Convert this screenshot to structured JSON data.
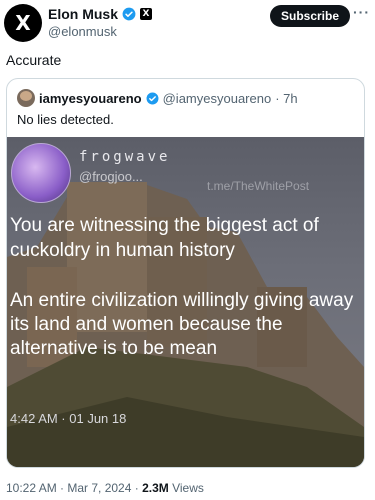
{
  "author": {
    "display_name": "Elon Musk",
    "handle": "@elonmusk",
    "avatar_icon": "x-logo-icon",
    "badge_icon": "x-affiliate-icon",
    "avatar_letter": "X",
    "badge_letter": "X"
  },
  "actions": {
    "subscribe_label": "Subscribe",
    "more_label": "···"
  },
  "tweet": {
    "text": "Accurate"
  },
  "quote": {
    "display_name": "iamyesyouareno",
    "handle": "@iamyesyouareno",
    "time": "· 7h",
    "text": "No lies detected.",
    "media": {
      "name": "frogwave",
      "handle": "@frogjoo...",
      "watermark": "t.me/TheWhitePost",
      "line1": "You are witnessing the biggest act of cuckoldry in human history",
      "line2": "An entire civilization willingly giving away its land and women because the alternative is to be mean",
      "timestamp": "4:42 AM · 01 Jun 18"
    }
  },
  "meta": {
    "time_date": "10:22 AM · Mar 7, 2024 · ",
    "views_count": "2.3M",
    "views_label": " Views"
  },
  "colors": {
    "verified": "#1d9bf0",
    "text": "#0f1419",
    "secondary": "#536471",
    "border": "#cfd9de"
  }
}
